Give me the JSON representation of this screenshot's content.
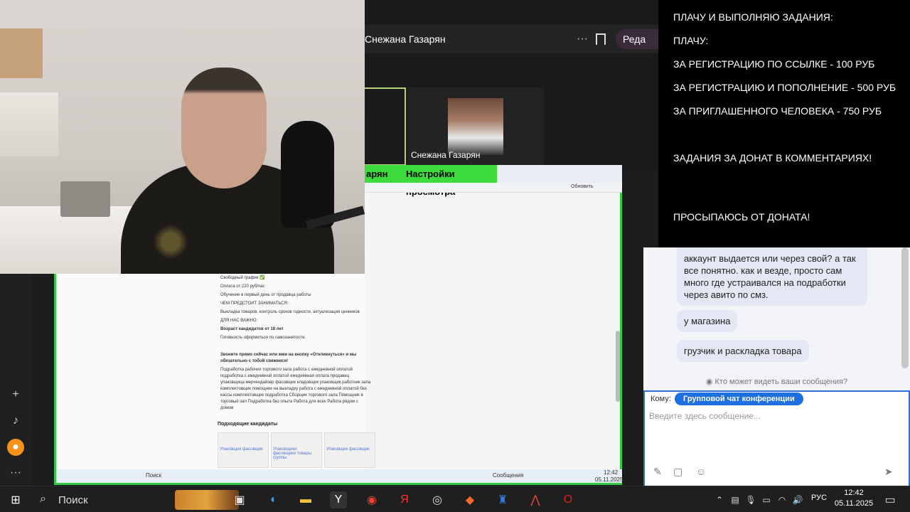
{
  "meeting": {
    "header_name": "Снежана Газарян",
    "header_dots": "···",
    "header_edit": "Реда",
    "participant_label": "Снежана Газарян"
  },
  "share": {
    "presenter_name": "арян",
    "settings_label": "Настройки просмотра",
    "browser_button": "Обновить",
    "doc_lines": [
      "Свободный график ✅",
      "Оплата от 220 руб/час",
      "Обучение в первый день от продавца работы",
      "ЧЕМ ПРЕДСТОИТ ЗАНИМАТЬСЯ:",
      "Выкладка товаров, контроль сроков годности, актуализация ценников",
      "ДЛЯ НАС ВАЖНО:",
      "Возраст кандидатов от 18 лет",
      "Готовность оформиться по самозанятости."
    ],
    "doc_cta": "Звоните прямо сейчас или жми на кнопку «Откликнуться» и мы обязательно с тобой свяжемся!",
    "doc_body": "Подработка рабочих торгового зала работа с ежедневной оплатой подработка с ежедневной оплатой ежедневная оплата продавец упаковщица мерчендайзер фасовщик кладовщик упаковщик работник зала комплектовщик помощник на выкладку работа с ежедневной оплатой без кассы комплектовщик подработка Сборщик торгового зала Помощник в торговый зал Подработка без опыта Работа для всех Работа рядом с домом",
    "candidates_label": "Подходящие кандидаты",
    "candidate_boxes": [
      "Упаковщик фасовщик",
      "Упаковщики фасовщики товары группы",
      "Упаковщик фасовщик"
    ],
    "mini_taskbar_search": "Поиск",
    "mini_messages": "Сообщения",
    "mini_time": "12:42",
    "mini_date": "05.11.2025"
  },
  "overlay": {
    "line1": "ПЛАЧУ И ВЫПОЛНЯЮ ЗАДАНИЯ:",
    "line2": "ПЛАЧУ:",
    "line3": " ЗА РЕГИСТРАЦИЮ ПО ССЫЛКЕ - 100 РУБ",
    "line4": "ЗА РЕГИСТРАЦИЮ И ПОПОЛНЕНИЕ - 500 РУБ",
    "line5": "ЗА ПРИГЛАШЕННОГО ЧЕЛОВЕКА - 750 РУБ",
    "line6": "ЗАДАНИЯ ЗА ДОНАТ В КОММЕНТАРИЯХ!",
    "line7": "ПРОСЫПАЮСЬ ОТ ДОНАТА!"
  },
  "chat": {
    "messages": [
      "аккаунт выдается или через свой? а так все понятно. как и везде, просто сам много где устраивался на подработки через авито по смз.",
      "у магазина",
      "грузчик и раскладка товара"
    ],
    "who_sees": "Кто может видеть ваши сообщения?",
    "to_label": "Кому:",
    "to_chip": "Групповой чат конференции",
    "input_placeholder": "Введите здесь сообщение..."
  },
  "taskbar": {
    "search_label": "Поиск",
    "lang": "РУС",
    "time": "12:42",
    "date": "05.11.2025"
  },
  "colors": {
    "accent_green": "#2ecc40",
    "chat_chip": "#1e6fe0",
    "overlay_bg": "#000000"
  },
  "icons": [
    "windows-start-icon",
    "search-icon",
    "task-view-icon",
    "edge-icon",
    "folder-icon",
    "yandex-icon",
    "chrome-icon",
    "yandex-y-icon",
    "obs-icon",
    "brave-icon",
    "vpn-icon",
    "chart-icon",
    "opera-icon",
    "tiktok-icon",
    "plus-icon",
    "more-icon"
  ]
}
